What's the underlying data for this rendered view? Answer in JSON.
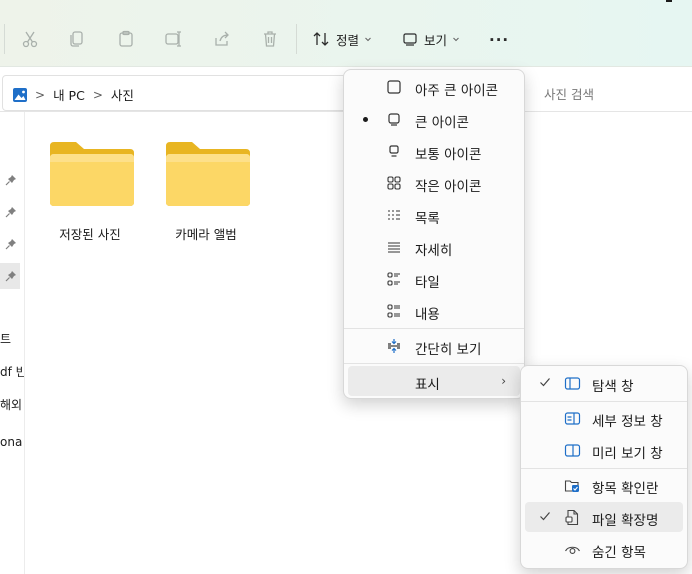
{
  "toolbar": {
    "sort_label": "정렬",
    "view_label": "보기",
    "more_label": "..."
  },
  "address": {
    "crumbs": [
      "내 PC",
      "사진"
    ],
    "search_placeholder": "사진 검색"
  },
  "nav_partial_texts": [
    "트",
    "df 빈",
    "해외",
    "ona"
  ],
  "folders": [
    {
      "name": "저장된 사진"
    },
    {
      "name": "카메라 앨범"
    }
  ],
  "view_menu": {
    "items": [
      {
        "label": "아주 큰 아이콘",
        "icon": "extra-large-icons-icon",
        "selected": false
      },
      {
        "label": "큰 아이콘",
        "icon": "large-icons-icon",
        "selected": true
      },
      {
        "label": "보통 아이콘",
        "icon": "medium-icons-icon",
        "selected": false
      },
      {
        "label": "작은 아이콘",
        "icon": "small-icons-icon",
        "selected": false
      },
      {
        "label": "목록",
        "icon": "list-icon",
        "selected": false
      },
      {
        "label": "자세히",
        "icon": "details-icon",
        "selected": false
      },
      {
        "label": "타일",
        "icon": "tiles-icon",
        "selected": false
      },
      {
        "label": "내용",
        "icon": "content-icon",
        "selected": false
      }
    ],
    "compact_label": "간단히 보기",
    "show_label": "표시",
    "show_arrow": "›"
  },
  "show_submenu": {
    "items": [
      {
        "label": "탐색 창",
        "icon": "navigation-pane-icon",
        "checked": true
      },
      {
        "label": "세부 정보 창",
        "icon": "details-pane-icon",
        "checked": false
      },
      {
        "label": "미리 보기 창",
        "icon": "preview-pane-icon",
        "checked": false
      },
      {
        "label": "항목 확인란",
        "icon": "item-checkboxes-icon",
        "checked": false
      },
      {
        "label": "파일 확장명",
        "icon": "file-extensions-icon",
        "checked": true
      },
      {
        "label": "숨긴 항목",
        "icon": "hidden-items-icon",
        "checked": false
      }
    ]
  },
  "colors": {
    "folder_back": "#e8b522",
    "folder_front": "#fcd766",
    "accent_blue": "#1f6fc8"
  }
}
